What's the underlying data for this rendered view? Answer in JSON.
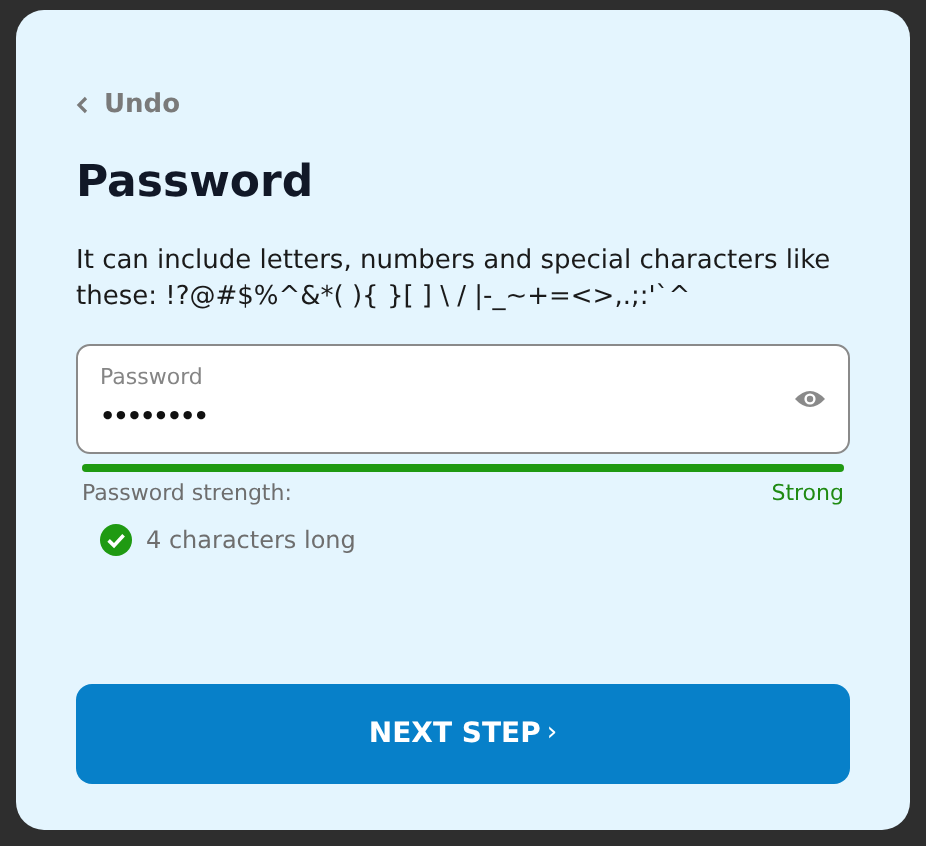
{
  "back_link": {
    "label": "Undo"
  },
  "title": "Password",
  "description": "It can include letters, numbers and special characters like these: !?@#$%^&*( ){ }[ ] \\ / |-_~+=<>,.;:'`^",
  "password_field": {
    "label": "Password",
    "value": "••••••••"
  },
  "strength": {
    "label": "Password strength:",
    "level": 1,
    "reading": "Strong"
  },
  "requirements": [
    {
      "label": "4 characters long",
      "met": true
    }
  ],
  "next_button": {
    "label": "NEXT STEP",
    "arrow": "›"
  }
}
